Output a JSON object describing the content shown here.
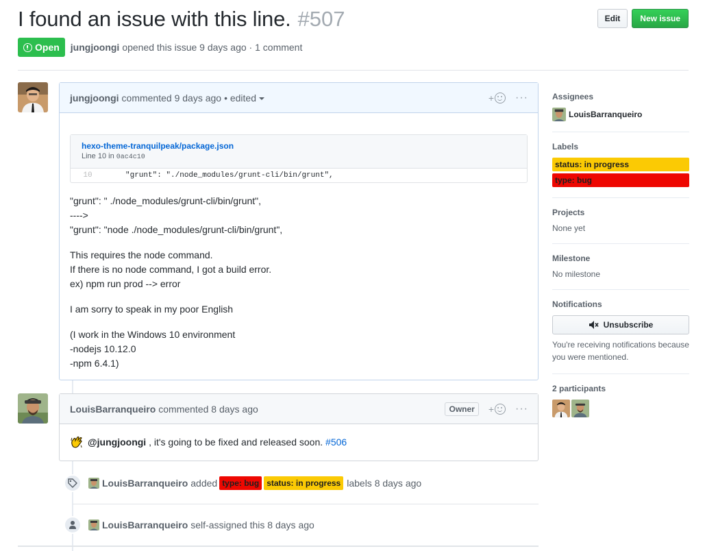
{
  "issue": {
    "title": "I found an issue with this line.",
    "number": "#507",
    "state": "Open",
    "author": "jungjoongi",
    "opened_text": "opened this issue 9 days ago · 1 comment"
  },
  "header_buttons": {
    "edit": "Edit",
    "new_issue": "New issue"
  },
  "comment1": {
    "author": "jungjoongi",
    "meta": "commented 9 days ago",
    "edited": "• edited",
    "reaction": "+",
    "more": "···",
    "snippet": {
      "file": "hexo-theme-tranquilpeak/package.json",
      "line_prefix": "Line 10 in",
      "commit": "0ac4c10",
      "line_no": "10",
      "code": "\"grunt\": \"./node_modules/grunt-cli/bin/grunt\","
    },
    "p1": [
      "\"grunt\": \" ./node_modules/grunt-cli/bin/grunt\",",
      "---->",
      "\"grunt\": \"node ./node_modules/grunt-cli/bin/grunt\","
    ],
    "p2": [
      "This requires the node command.",
      "If there is no node command, I got a build error.",
      "ex) npm run prod --> error"
    ],
    "p3": [
      "I am sorry to speak in my poor English"
    ],
    "p4": [
      "(I work in the Windows 10 environment",
      "-nodejs 10.12.0",
      "-npm 6.4.1)"
    ]
  },
  "comment2": {
    "author": "LouisBarranqueiro",
    "meta": "commented 8 days ago",
    "owner_badge": "Owner",
    "reaction": "+",
    "more": "···",
    "mention": "@jungjoongi",
    "text": ", it's going to be fixed and released soon.",
    "link": "#506"
  },
  "event1": {
    "author": "LouisBarranqueiro",
    "verb": "added",
    "label1": "type: bug",
    "label2": "status: in progress",
    "suffix": "labels 8 days ago"
  },
  "event2": {
    "author": "LouisBarranqueiro",
    "text": "self-assigned this 8 days ago"
  },
  "sidebar": {
    "assignees_title": "Assignees",
    "assignee": "LouisBarranqueiro",
    "labels_title": "Labels",
    "labels": [
      {
        "name": "status: in progress",
        "color": "#fbca04"
      },
      {
        "name": "type: bug",
        "color": "#ee0701"
      }
    ],
    "projects_title": "Projects",
    "projects_value": "None yet",
    "milestone_title": "Milestone",
    "milestone_value": "No milestone",
    "notifications_title": "Notifications",
    "unsubscribe": "Unsubscribe",
    "notifications_note": "You're receiving notifications because you were mentioned.",
    "participants_title": "2 participants"
  },
  "colors": {
    "open_green": "#2cbe4e",
    "link_blue": "#0366d6",
    "label_bug": "#ee0701",
    "label_progress": "#fbca04"
  }
}
